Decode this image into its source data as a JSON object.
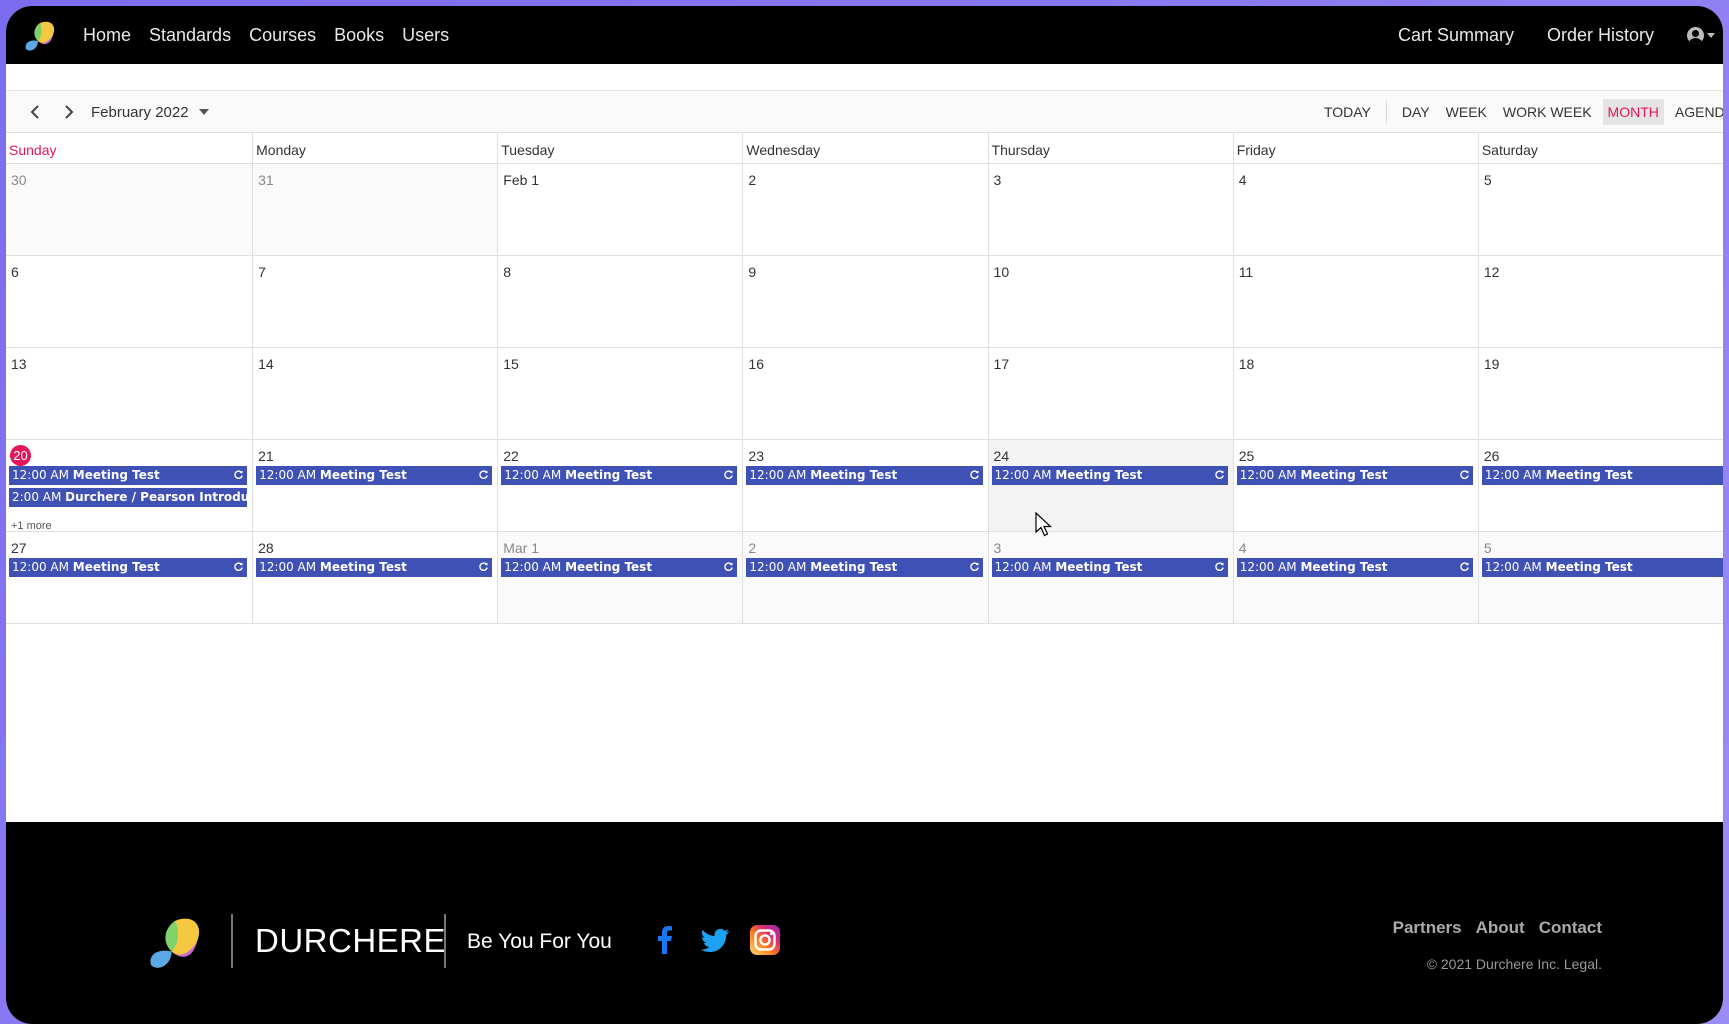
{
  "nav": {
    "links": [
      "Home",
      "Standards",
      "Courses",
      "Books",
      "Users"
    ],
    "right_links": [
      "Cart Summary",
      "Order History"
    ]
  },
  "toolbar": {
    "date_label": "February 2022",
    "views": [
      "TODAY",
      "DAY",
      "WEEK",
      "WORK WEEK",
      "MONTH",
      "AGENDA"
    ],
    "active_view": "MONTH"
  },
  "calendar": {
    "days_of_week": [
      "Sunday",
      "Monday",
      "Tuesday",
      "Wednesday",
      "Thursday",
      "Friday",
      "Saturday"
    ],
    "weeks": [
      [
        "30",
        "31",
        "Feb 1",
        "2",
        "3",
        "4",
        "5"
      ],
      [
        "6",
        "7",
        "8",
        "9",
        "10",
        "11",
        "12"
      ],
      [
        "13",
        "14",
        "15",
        "16",
        "17",
        "18",
        "19"
      ],
      [
        "20",
        "21",
        "22",
        "23",
        "24",
        "25",
        "26"
      ],
      [
        "27",
        "28",
        "Mar 1",
        "2",
        "3",
        "4",
        "5"
      ]
    ],
    "event_time": "12:00 AM",
    "event_title": "Meeting Test",
    "extra_event_time": "2:00 AM",
    "extra_event_title": "Durchere / Pearson Introduc...",
    "more_label": "+1 more"
  },
  "footer": {
    "brand": "DURCHERE",
    "tagline": "Be You For You",
    "links": [
      "Partners",
      "About",
      "Contact"
    ],
    "copyright": "© 2021 Durchere Inc. Legal."
  },
  "colors": {
    "accent": "#e3165b",
    "event": "#3f51b5"
  }
}
